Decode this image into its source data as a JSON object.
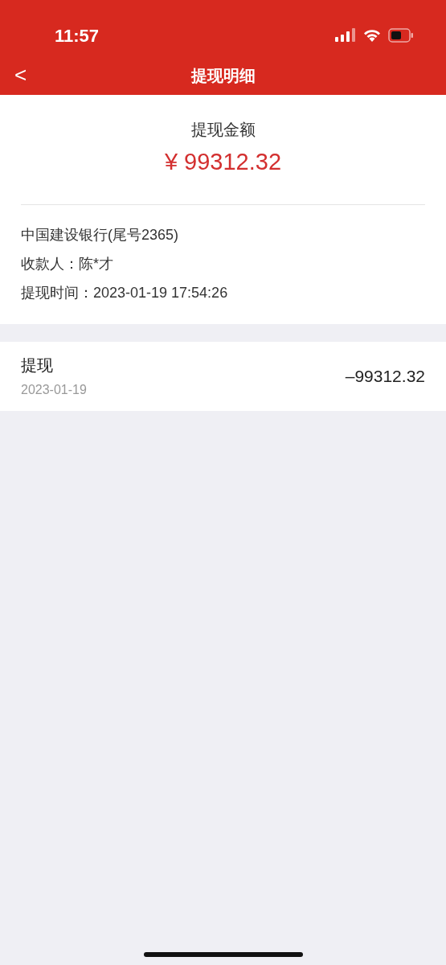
{
  "status_bar": {
    "time": "11:57"
  },
  "nav": {
    "back": "<",
    "title": "提现明细"
  },
  "summary": {
    "label": "提现金额",
    "amount": "¥ 99312.32"
  },
  "details": [
    "中国建设银行(尾号2365)",
    "收款人：陈*才",
    "提现时间：2023-01-19 17:54:26"
  ],
  "records": [
    {
      "title": "提现",
      "date": "2023-01-19",
      "amount": "–99312.32"
    }
  ]
}
